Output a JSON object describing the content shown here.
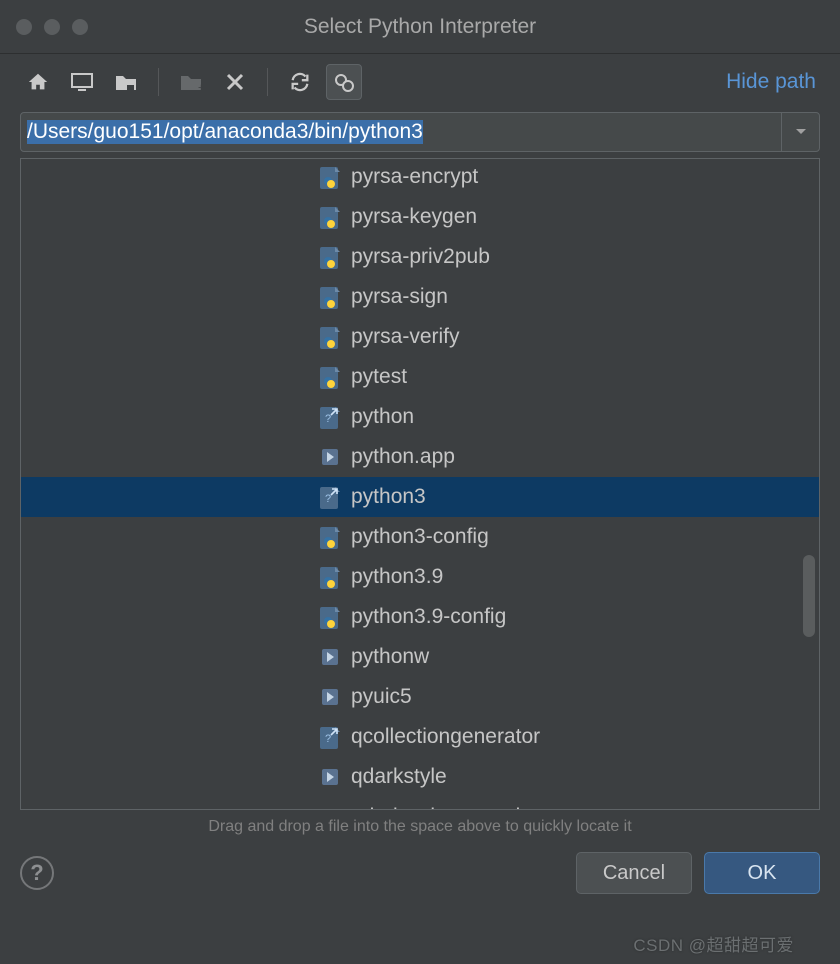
{
  "window": {
    "title": "Select Python Interpreter",
    "hide_path_label": "Hide path"
  },
  "path": {
    "value": "/Users/guo151/opt/anaconda3/bin/python3"
  },
  "tree": {
    "items": [
      {
        "label": "pyrsa-encrypt",
        "icon": "py",
        "selected": false
      },
      {
        "label": "pyrsa-keygen",
        "icon": "py",
        "selected": false
      },
      {
        "label": "pyrsa-priv2pub",
        "icon": "py",
        "selected": false
      },
      {
        "label": "pyrsa-sign",
        "icon": "py",
        "selected": false
      },
      {
        "label": "pyrsa-verify",
        "icon": "py",
        "selected": false
      },
      {
        "label": "pytest",
        "icon": "py",
        "selected": false
      },
      {
        "label": "python",
        "icon": "link",
        "selected": false
      },
      {
        "label": "python.app",
        "icon": "folder",
        "selected": false
      },
      {
        "label": "python3",
        "icon": "link",
        "selected": true
      },
      {
        "label": "python3-config",
        "icon": "py",
        "selected": false
      },
      {
        "label": "python3.9",
        "icon": "py",
        "selected": false
      },
      {
        "label": "python3.9-config",
        "icon": "py",
        "selected": false
      },
      {
        "label": "pythonw",
        "icon": "folder",
        "selected": false
      },
      {
        "label": "pyuic5",
        "icon": "folder",
        "selected": false
      },
      {
        "label": "qcollectiongenerator",
        "icon": "link",
        "selected": false
      },
      {
        "label": "qdarkstyle",
        "icon": "folder",
        "selected": false
      },
      {
        "label": "qdarkstyle.example",
        "icon": "folder",
        "selected": false
      }
    ]
  },
  "hint": "Drag and drop a file into the space above to quickly locate it",
  "buttons": {
    "cancel": "Cancel",
    "ok": "OK",
    "help": "?"
  },
  "watermark": "CSDN @超甜超可爱"
}
